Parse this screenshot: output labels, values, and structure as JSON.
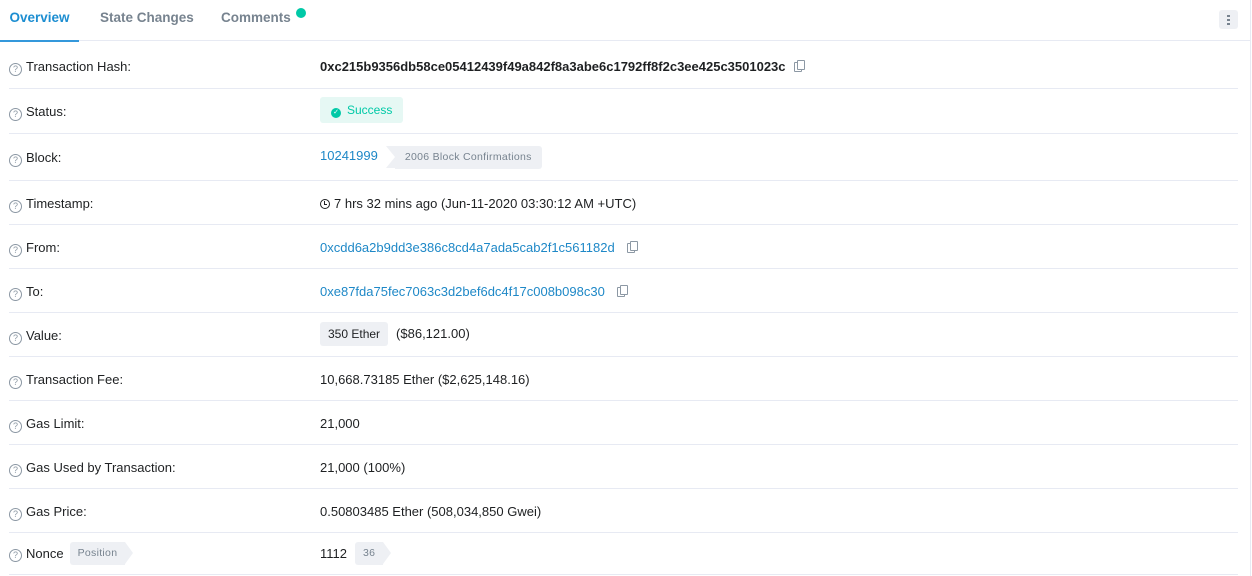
{
  "tabs": [
    {
      "label": "Overview",
      "active": true
    },
    {
      "label": "State Changes",
      "active": false
    },
    {
      "label": "Comments",
      "active": false,
      "notification": true
    }
  ],
  "more_menu": {
    "icon": "vertical-ellipsis-icon"
  },
  "rows": {
    "tx_hash": {
      "label": "Transaction Hash:",
      "value": "0xc215b9356db58ce05412439f49a842f8a3abe6c1792ff8f2c3ee425c3501023c",
      "icon": "copy-icon"
    },
    "status": {
      "label": "Status:",
      "value": "Success",
      "color": "#00c9a7"
    },
    "block": {
      "label": "Block:",
      "value": "10241999",
      "confirmations": "2006 Block Confirmations"
    },
    "timestamp": {
      "label": "Timestamp:",
      "value": "7 hrs 32 mins ago (Jun-11-2020 03:30:12 AM +UTC)"
    },
    "from": {
      "label": "From:",
      "value": "0xcdd6a2b9dd3e386c8cd4a7ada5cab2f1c561182d"
    },
    "to": {
      "label": "To:",
      "value": "0xe87fda75fec7063c3d2bef6dc4f17c008b098c30"
    },
    "value": {
      "label": "Value:",
      "ether": "350 Ether",
      "usd": "($86,121.00)"
    },
    "tx_fee": {
      "label": "Transaction Fee:",
      "value": "10,668.73185 Ether ($2,625,148.16)"
    },
    "gas_limit": {
      "label": "Gas Limit:",
      "value": "21,000"
    },
    "gas_used": {
      "label": "Gas Used by Transaction:",
      "value": "21,000 (100%)"
    },
    "gas_price": {
      "label": "Gas Price:",
      "value": "0.50803485 Ether (508,034,850 Gwei)"
    },
    "nonce": {
      "label": "Nonce",
      "position_label": "Position",
      "value": "1112",
      "position": "36"
    }
  },
  "colors": {
    "accent": "#3498db",
    "link": "#1e88c7",
    "success": "#00c9a7",
    "muted": "#77838f"
  }
}
